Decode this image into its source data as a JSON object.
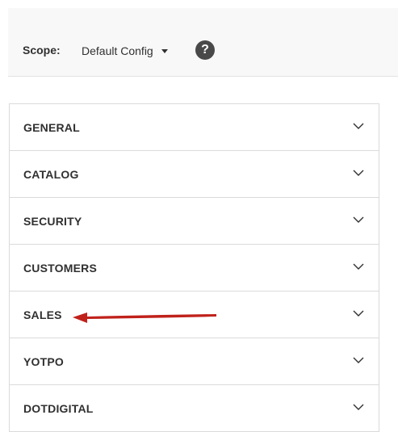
{
  "scope": {
    "label": "Scope:",
    "selected": "Default Config",
    "help_icon": "help-icon",
    "help_glyph": "?"
  },
  "sections": [
    {
      "label": "GENERAL"
    },
    {
      "label": "CATALOG"
    },
    {
      "label": "SECURITY"
    },
    {
      "label": "CUSTOMERS"
    },
    {
      "label": "SALES"
    },
    {
      "label": "YOTPO"
    },
    {
      "label": "DOTDIGITAL"
    }
  ],
  "annotation": {
    "arrow_color": "#c0211b",
    "points_to": "SALES"
  },
  "colors": {
    "border": "#dadada",
    "text": "#303030",
    "scope_bg": "#f8f8f8"
  }
}
